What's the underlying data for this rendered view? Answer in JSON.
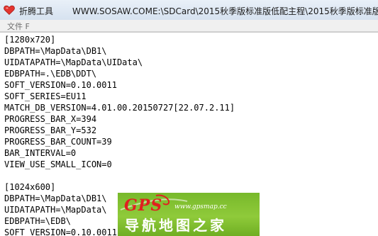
{
  "window": {
    "app_title": "折腾工具",
    "path": "WWW.SOSAW.COME:\\SDCard\\2015秋季版标准版低配主程\\2015秋季版标准版"
  },
  "menu": {
    "file_label": "文件 F"
  },
  "editor": {
    "lines": [
      "[1280x720]",
      "DBPATH=\\MapData\\DB1\\",
      "UIDATAPATH=\\MapData\\UIData\\",
      "EDBPATH=.\\EDB\\DDT\\",
      "SOFT_VERSION=0.10.0011",
      "SOFT_SERIES=EU11",
      "MATCH_DB_VERSION=4.01.00.20150727[22.07.2.11]",
      "PROGRESS_BAR_X=394",
      "PROGRESS_BAR_Y=532",
      "PROGRESS_BAR_COUNT=39",
      "BAR_INTERVAL=0",
      "VIEW_USE_SMALL_ICON=0",
      "",
      "[1024x600]",
      "DBPATH=\\MapData\\DB1\\",
      "UIDATAPATH=\\MapData\\",
      "EDBPATH=\\EDB\\",
      "SOFT_VERSION=0.10.0011"
    ]
  },
  "watermark": {
    "brand": "GPS",
    "url": "www.gpsmap.cc",
    "name": "导航地图之家"
  },
  "colors": {
    "title_bar": "#dfe8f3",
    "text": "#000000",
    "watermark_bg": "#82c232",
    "watermark_brand": "#e02020"
  }
}
